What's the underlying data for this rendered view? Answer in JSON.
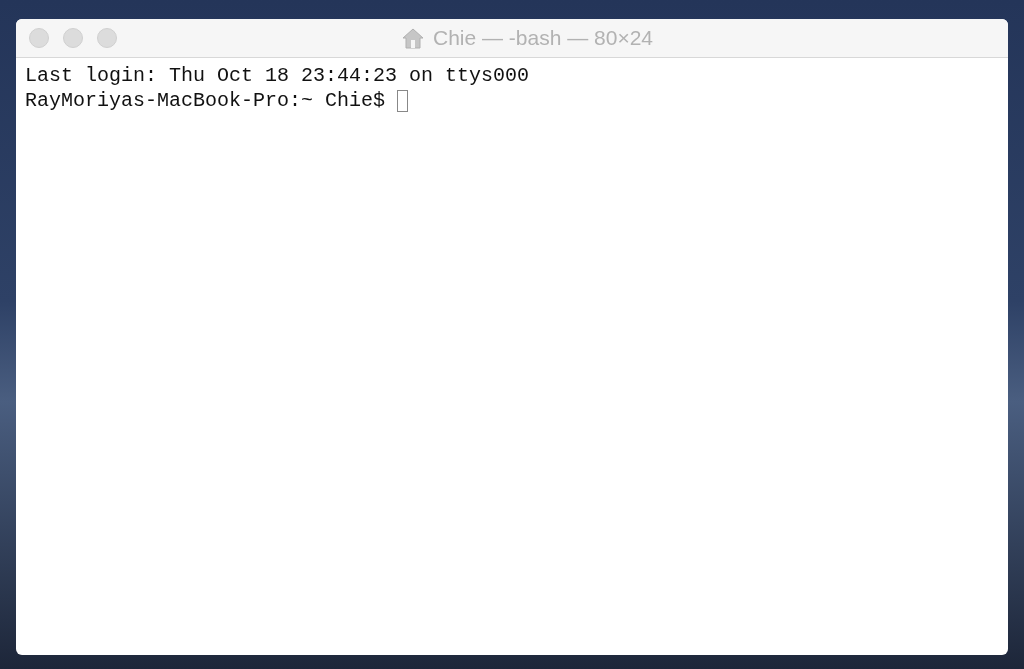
{
  "window": {
    "title": "Chie — -bash — 80×24"
  },
  "terminal": {
    "lines": [
      "Last login: Thu Oct 18 23:44:23 on ttys000",
      "RayMoriyas-MacBook-Pro:~ Chie$ "
    ]
  }
}
